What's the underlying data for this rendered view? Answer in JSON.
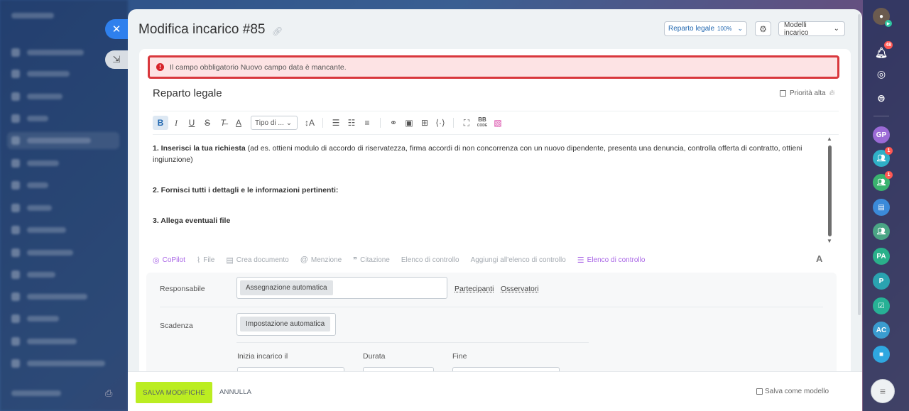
{
  "header": {
    "title": "Modifica incarico #85",
    "project_label": "Reparto legale",
    "project_percent": "100%",
    "templates_label": "Modelli incarico"
  },
  "alert": {
    "message": "Il campo obbligatorio Nuovo campo data è mancante."
  },
  "task": {
    "title": "Reparto legale",
    "priority_label": "Priorità alta"
  },
  "toolbar": {
    "font_select": "Tipo di ...",
    "bbcode_top": "BB",
    "bbcode_bottom": "CODE"
  },
  "editor": {
    "line1_bold": "1. Inserisci la tua richiesta",
    "line1_rest": " (ad es. ottieni modulo di accordo di riservatezza, firma accordi di non concorrenza con un nuovo dipendente, presenta una denuncia, controlla offerta di contratto, ottieni ingiunzione)",
    "line2": "2. Fornisci tutti i dettagli e le informazioni pertinenti:",
    "line3": "3. Allega eventuali file"
  },
  "actions": {
    "copilot": "CoPilot",
    "file": "File",
    "create_doc": "Crea documento",
    "mention": "Menzione",
    "quote": "Citazione",
    "checklist": "Elenco di controllo",
    "add_to_checklist": "Aggiungi all'elenco di controllo",
    "checklist_ai": "Elenco di controllo",
    "text_format": "A"
  },
  "fields": {
    "responsible_label": "Responsabile",
    "responsible_value": "Assegnazione automatica",
    "participants_link": "Partecipanti",
    "observers_link": "Osservatori",
    "deadline_label": "Scadenza",
    "deadline_value": "Impostazione automatica",
    "start_label": "Inizia incarico il",
    "duration_label": "Durata",
    "end_label": "Fine"
  },
  "footer": {
    "save_label": "SALVA MODIFICHE",
    "cancel_label": "ANNULLA",
    "save_template_label": "Salva come modello"
  },
  "right_sidebar": {
    "notifications_count": "48",
    "group1_badge": "1",
    "group2_badge": "1",
    "avatar_gp": "GP",
    "avatar_pa": "PA",
    "avatar_p": "P",
    "avatar_ac": "AC"
  },
  "colors": {
    "accent": "#2f80ed",
    "save_button": "#bbed21",
    "alert_border": "#d9383d",
    "alert_bg": "#fde3e4",
    "copilot": "#a864e6"
  }
}
